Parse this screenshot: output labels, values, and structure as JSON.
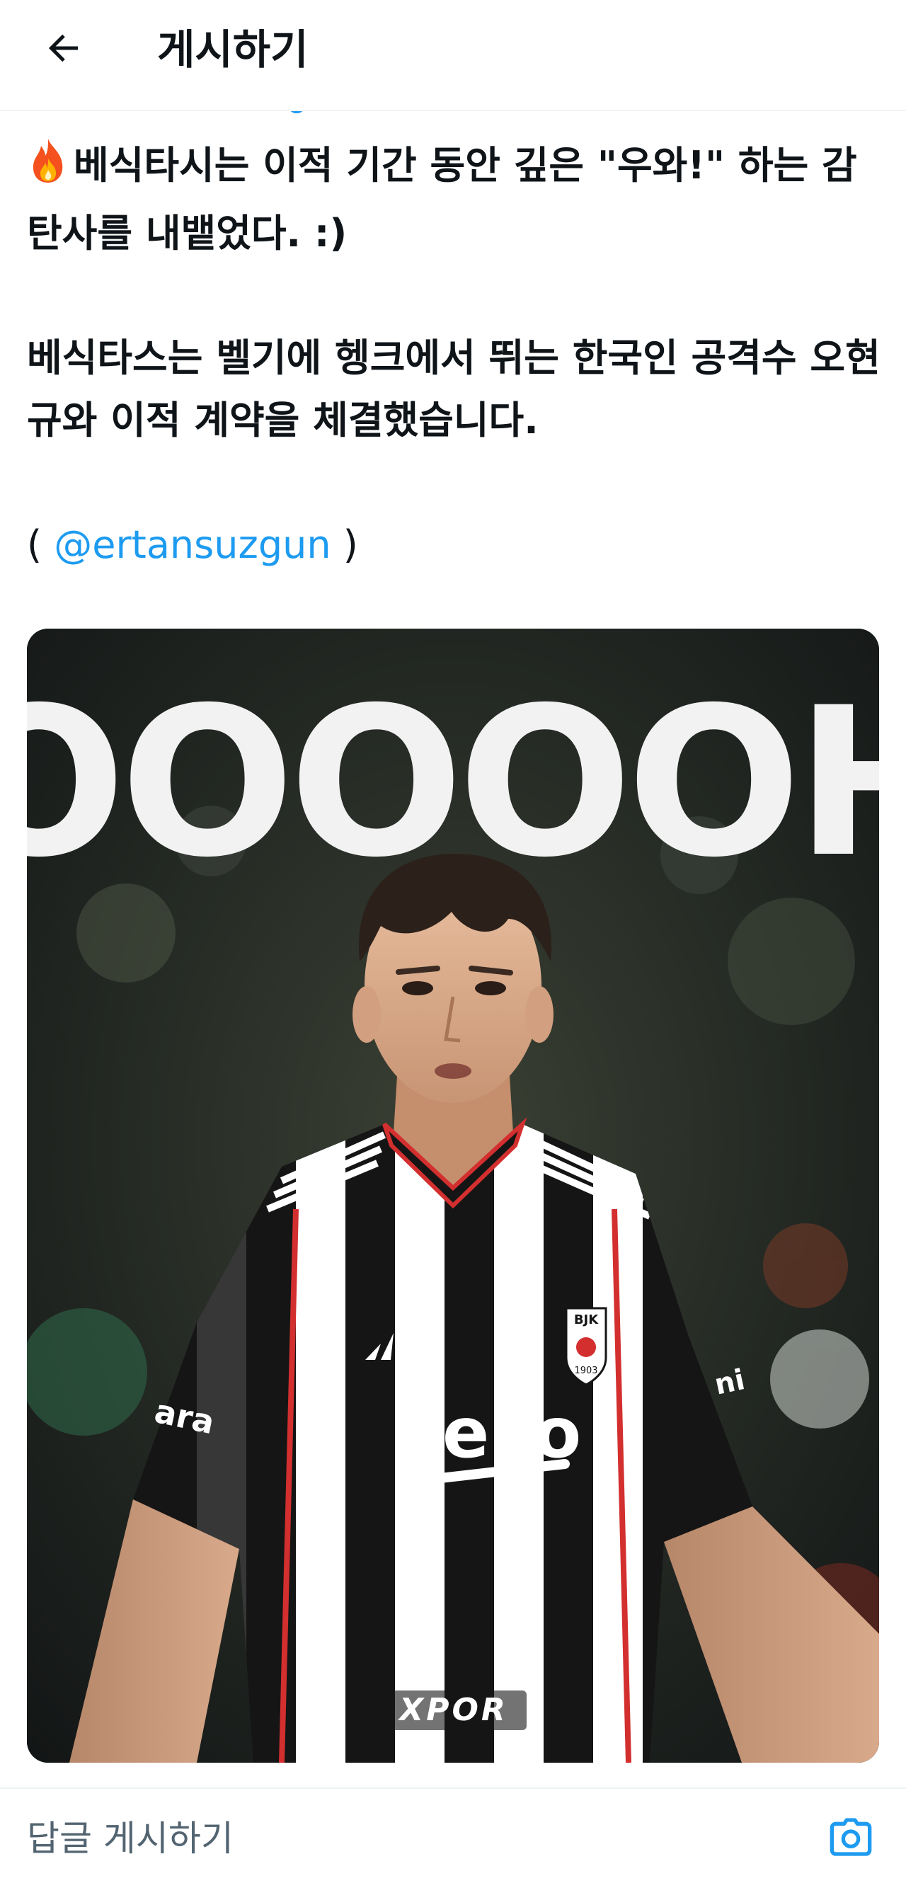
{
  "header": {
    "title": "게시하기",
    "back_icon": "arrow-left-icon"
  },
  "tweet": {
    "emoji": "fire-icon",
    "line1": "베식타시는 이적 기간 동안 깊은 \"우와!\" 하는 감탄사를 내뱉었다. :)",
    "line2": "베식타스는 벨기에 헹크에서 뛰는 한국인 공격수 오현규와 이적 계약을 체결했습니다.",
    "source_open": "( ",
    "mention": "@ertansuzgun",
    "source_close": " )"
  },
  "media": {
    "headline": "OOOOOH",
    "sponsor": "beko",
    "sleeve_left": "ara",
    "sleeve_right": "ni",
    "badge": "BJK",
    "badge_year": "1903",
    "watermark": "XPOR"
  },
  "reply": {
    "placeholder": "답글 게시하기",
    "camera_icon": "camera-icon"
  },
  "colors": {
    "accent": "#1d9bf0",
    "text": "#0f1419",
    "muted": "#536471"
  }
}
